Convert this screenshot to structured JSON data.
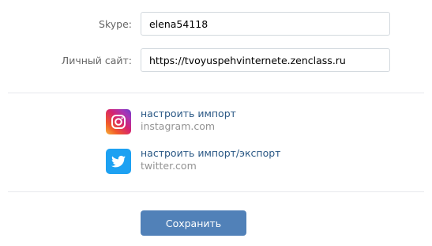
{
  "fields": {
    "skype": {
      "label": "Skype:",
      "value": "elena54118"
    },
    "website": {
      "label": "Личный сайт:",
      "value": "https://tvoyuspehvinternete.zenclass.ru"
    }
  },
  "services": [
    {
      "icon": "instagram-icon",
      "action_label": "настроить импорт",
      "domain": "instagram.com",
      "color": "#d6246e"
    },
    {
      "icon": "twitter-icon",
      "action_label": "настроить импорт/экспорт",
      "domain": "twitter.com",
      "color": "#1da1f2"
    }
  ],
  "actions": {
    "save_label": "Сохранить"
  },
  "colors": {
    "link": "#2a5885",
    "button": "#5181b8",
    "muted": "#939393",
    "label": "#656565"
  }
}
